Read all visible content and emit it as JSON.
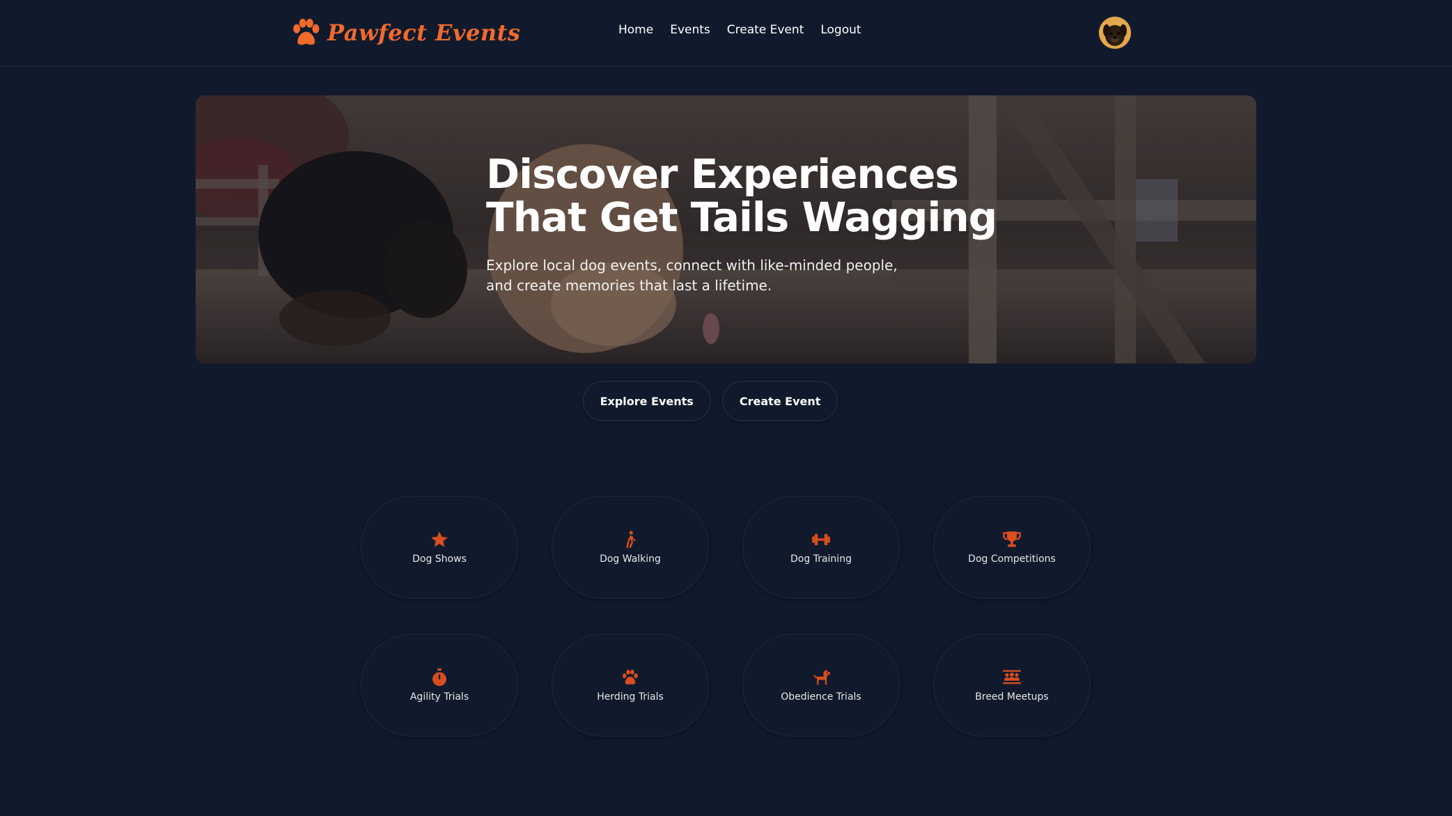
{
  "brand": {
    "name": "Pawfect Events",
    "logo_icon": "paw-icon",
    "color": "#f06a2c"
  },
  "nav": {
    "items": [
      {
        "label": "Home"
      },
      {
        "label": "Events"
      },
      {
        "label": "Create Event"
      },
      {
        "label": "Logout"
      }
    ]
  },
  "user": {
    "avatar_icon": "avatar"
  },
  "hero": {
    "title": "Discover Experiences That Get Tails Wagging",
    "subtitle": "Explore local dog events, connect with like-minded people, and create memories that last a lifetime."
  },
  "actions": {
    "explore_label": "Explore Events",
    "create_label": "Create Event"
  },
  "categories": [
    {
      "label": "Dog Shows",
      "icon": "star-icon"
    },
    {
      "label": "Dog Walking",
      "icon": "walking-person-icon"
    },
    {
      "label": "Dog Training",
      "icon": "dumbbell-icon"
    },
    {
      "label": "Dog Competitions",
      "icon": "trophy-icon"
    },
    {
      "label": "Agility Trials",
      "icon": "stopwatch-icon"
    },
    {
      "label": "Herding Trials",
      "icon": "paw-icon"
    },
    {
      "label": "Obedience Trials",
      "icon": "dog-icon"
    },
    {
      "label": "Breed Meetups",
      "icon": "people-group-icon"
    }
  ],
  "colors": {
    "background": "#111a2c",
    "accent": "#d94e1f"
  }
}
